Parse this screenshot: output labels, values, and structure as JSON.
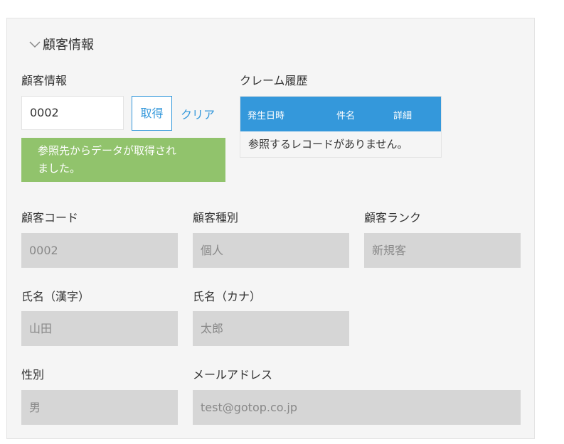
{
  "section": {
    "title": "顧客情報"
  },
  "lookup": {
    "label": "顧客情報",
    "value": "0002",
    "get_button": "取得",
    "clear_link": "クリア",
    "notice_line1": "参照先からデータが取得され",
    "notice_line2": "ました。"
  },
  "claims": {
    "label": "クレーム履歴",
    "columns": [
      "発生日時",
      "件名",
      "詳細"
    ],
    "empty_message": "参照するレコードがありません。"
  },
  "fields": {
    "customer_code": {
      "label": "顧客コード",
      "value": "0002"
    },
    "customer_type": {
      "label": "顧客種別",
      "value": "個人"
    },
    "customer_rank": {
      "label": "顧客ランク",
      "value": "新規客"
    },
    "name_kanji": {
      "label": "氏名（漢字）",
      "value": "山田"
    },
    "name_kana": {
      "label": "氏名（カナ）",
      "value": "太郎"
    },
    "gender": {
      "label": "性別",
      "value": "男"
    },
    "email": {
      "label": "メールアドレス",
      "value": "test@gotop.co.jp"
    }
  },
  "colors": {
    "accent": "#3498db",
    "notice": "#91c36c",
    "field_bg": "#d6d6d6",
    "panel_bg": "#f5f5f5"
  }
}
